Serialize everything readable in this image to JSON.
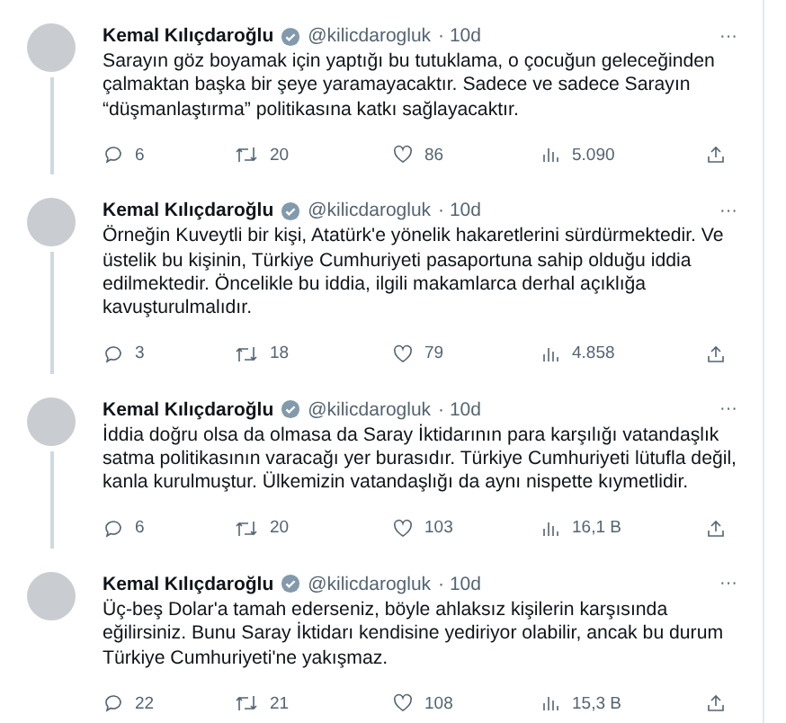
{
  "tweets": [
    {
      "name": "Kemal Kılıçdaroğlu",
      "verified": true,
      "handle": "@kilicdarogluk",
      "time": "· 10d",
      "more": "···",
      "lines": [
        "Sarayın göz boyamak için yaptığı bu tutuklama, o çocuğun geleceğinden",
        "çalmaktan başka bir şeye yaramayacaktır. Sadece ve sadece Sarayın",
        "“düşmanlaştırma” politikasına katkı sağlayacaktır."
      ],
      "replies": "6",
      "retweets": "20",
      "likes": "86",
      "views": "5.090"
    },
    {
      "name": "Kemal Kılıçdaroğlu",
      "verified": true,
      "handle": "@kilicdarogluk",
      "time": "· 10d",
      "more": "···",
      "lines": [
        "Örneğin Kuveytli bir kişi, Atatürk'e yönelik hakaretlerini sürdürmektedir. Ve",
        "üstelik bu kişinin, Türkiye Cumhuriyeti pasaportuna sahip olduğu iddia",
        "edilmektedir. Öncelikle bu iddia, ilgili makamlarca derhal açıklığa",
        "kavuşturulmalıdır."
      ],
      "replies": "3",
      "retweets": "18",
      "likes": "79",
      "views": "4.858"
    },
    {
      "name": "Kemal Kılıçdaroğlu",
      "verified": true,
      "handle": "@kilicdarogluk",
      "time": "· 10d",
      "more": "···",
      "lines": [
        "İddia doğru olsa da olmasa da Saray İktidarının para karşılığı vatandaşlık",
        "satma politikasının varacağı yer burasıdır. Türkiye Cumhuriyeti lütufla değil,",
        "kanla kurulmuştur. Ülkemizin vatandaşlığı da aynı nispette kıymetlidir."
      ],
      "replies": "6",
      "retweets": "20",
      "likes": "103",
      "views": "16,1 B"
    },
    {
      "name": "Kemal Kılıçdaroğlu",
      "verified": true,
      "handle": "@kilicdarogluk",
      "time": "· 10d",
      "more": "···",
      "lines": [
        "Üç-beş Dolar'a tamah ederseniz, böyle ahlaksız kişilerin karşısında",
        "eğilirsiniz. Bunu Saray İktidarı kendisine yediriyor olabilir, ancak bu durum",
        "Türkiye Cumhuriyeti'ne yakışmaz."
      ],
      "replies": "22",
      "retweets": "21",
      "likes": "108",
      "views": "15,3 B"
    }
  ]
}
